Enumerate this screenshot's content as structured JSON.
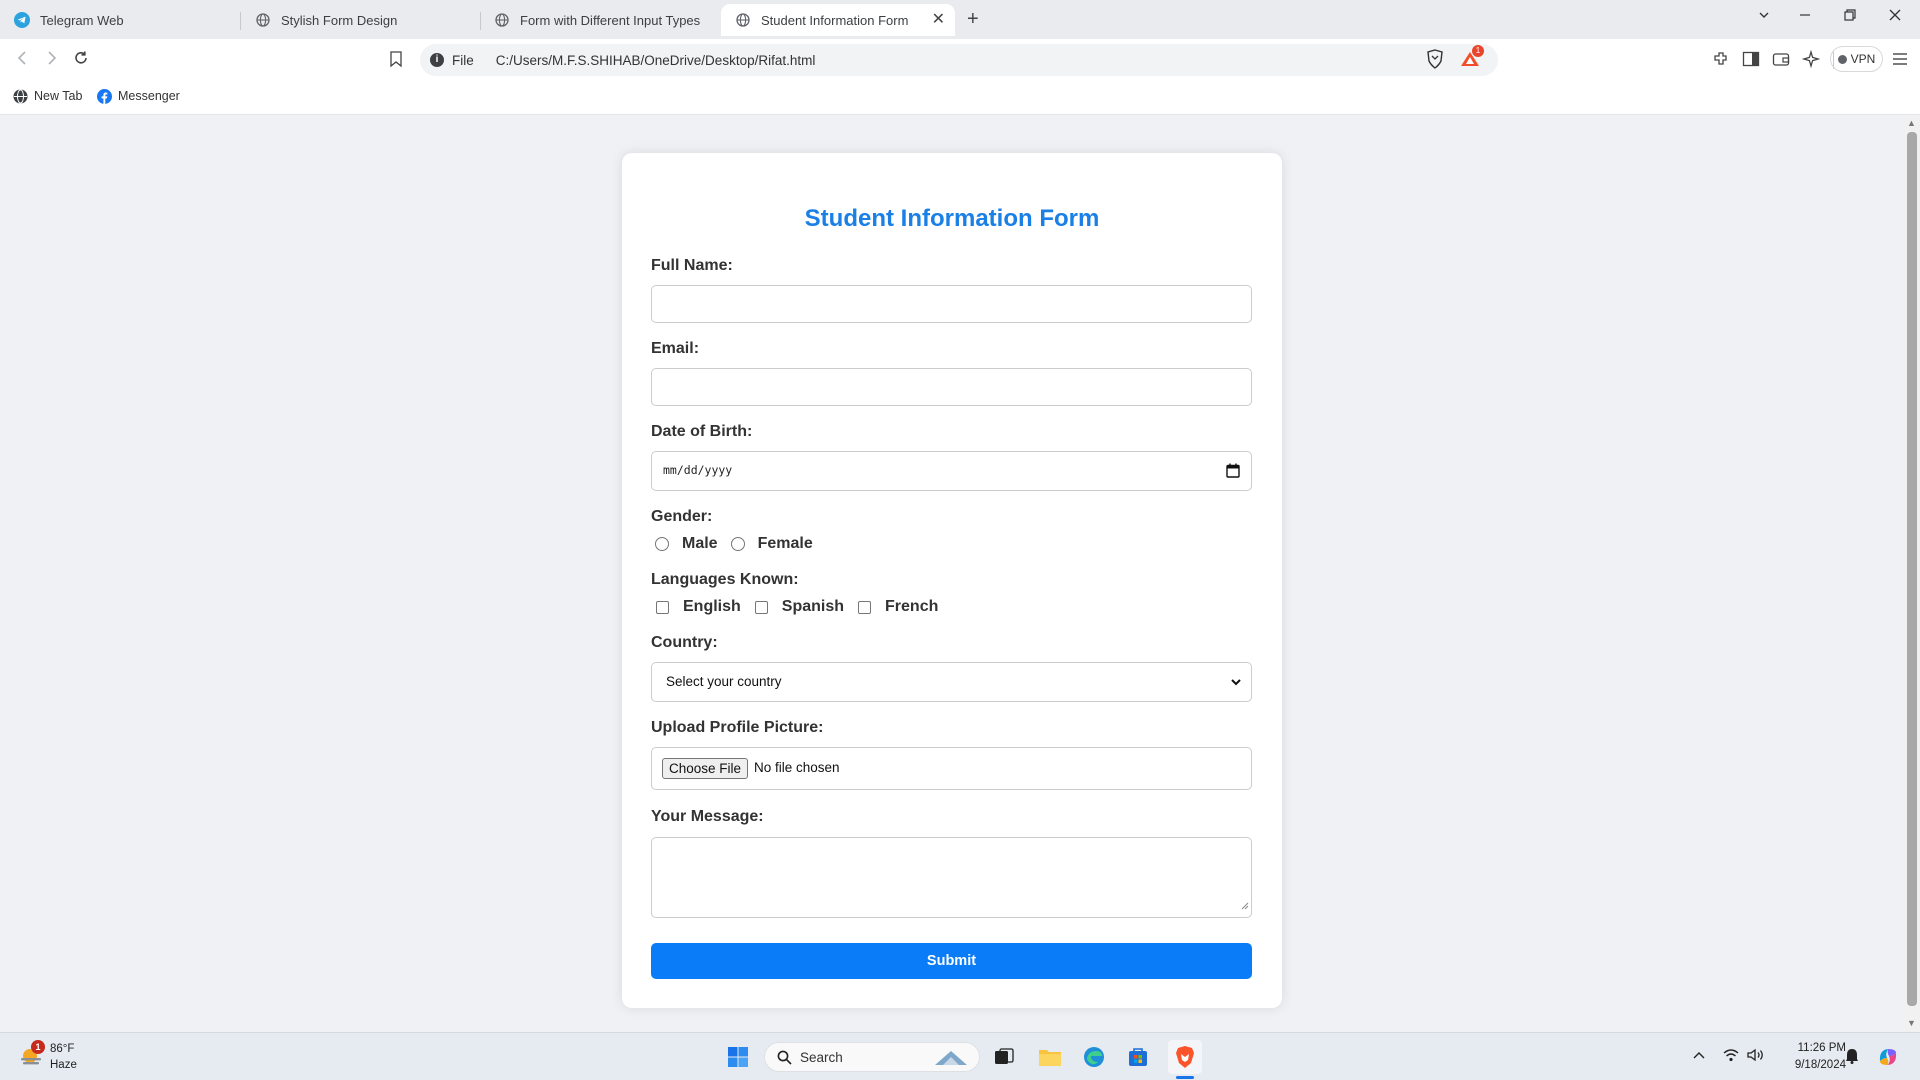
{
  "browser": {
    "tabs": [
      {
        "title": "Telegram Web",
        "icon": "telegram-icon"
      },
      {
        "title": "Stylish Form Design",
        "icon": "globe-icon"
      },
      {
        "title": "Form with Different Input Types",
        "icon": "globe-icon"
      },
      {
        "title": "Student Information Form",
        "icon": "globe-icon",
        "active": true
      }
    ],
    "new_tab_glyph": "+",
    "address": {
      "scheme_label": "File",
      "url": "C:/Users/M.F.S.SHIHAB/OneDrive/Desktop/Rifat.html"
    },
    "notification_count": "1",
    "vpn_label": "VPN",
    "bookmarks": [
      {
        "label": "New Tab",
        "icon": "globe-icon"
      },
      {
        "label": "Messenger",
        "icon": "facebook-icon"
      }
    ]
  },
  "form": {
    "title": "Student Information Form",
    "full_name": {
      "label": "Full Name:",
      "value": ""
    },
    "email": {
      "label": "Email:",
      "value": ""
    },
    "dob": {
      "label": "Date of Birth:",
      "placeholder": "mm/dd/yyyy"
    },
    "gender": {
      "label": "Gender:",
      "options": [
        "Male",
        "Female"
      ]
    },
    "languages": {
      "label": "Languages Known:",
      "options": [
        "English",
        "Spanish",
        "French"
      ]
    },
    "country": {
      "label": "Country:",
      "selected": "Select your country"
    },
    "upload": {
      "label": "Upload Profile Picture:",
      "button": "Choose File",
      "status": "No file chosen"
    },
    "message": {
      "label": "Your Message:",
      "value": ""
    },
    "submit": "Submit"
  },
  "taskbar": {
    "weather": {
      "temp": "86°F",
      "condition": "Haze",
      "badge": "1"
    },
    "search_label": "Search",
    "time": "11:26 PM",
    "date": "9/18/2024"
  },
  "colors": {
    "accent": "#0a7cf7",
    "title": "#1a80e6",
    "page_bg": "#eff1f5"
  }
}
